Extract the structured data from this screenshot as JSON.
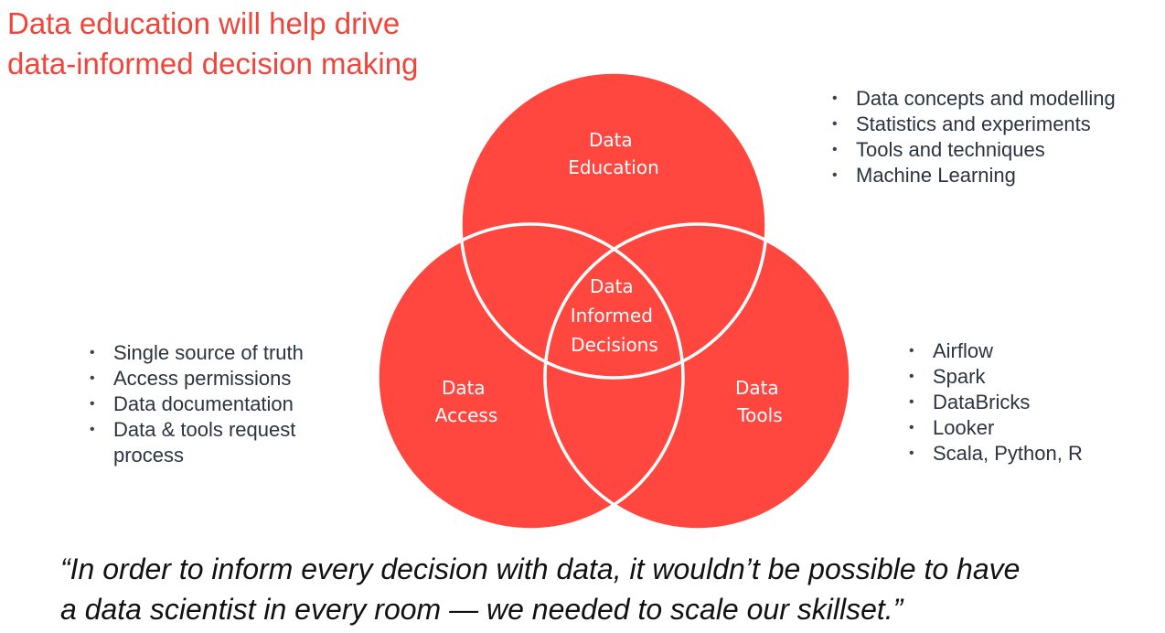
{
  "title": {
    "line1": "Data education will help drive",
    "line2": "data-informed decision making"
  },
  "colors": {
    "accent": "#f0453b",
    "circle_fill": "#ff463f",
    "circle_stroke": "#ffffff",
    "bullet_text": "#2b3440"
  },
  "venn": {
    "education": {
      "line1": "Data",
      "line2": "Education"
    },
    "access": {
      "line1": "Data",
      "line2": "Access"
    },
    "tools": {
      "line1": "Data",
      "line2": "Tools"
    },
    "center": {
      "line1": "Data",
      "line2": "Informed",
      "line3": "Decisions"
    }
  },
  "lists": {
    "education": [
      "Data concepts and modelling",
      "Statistics and experiments",
      "Tools and techniques",
      "Machine Learning"
    ],
    "access": [
      "Single source of truth",
      "Access permissions",
      "Data documentation",
      "Data & tools request process"
    ],
    "tools": [
      "Airflow",
      "Spark",
      "DataBricks",
      "Looker",
      "Scala, Python, R"
    ]
  },
  "quote": {
    "line1": "“In order to inform every decision with data, it wouldn’t be possible to have",
    "line2": "a data scientist in every room — we needed to scale our skillset.”"
  }
}
